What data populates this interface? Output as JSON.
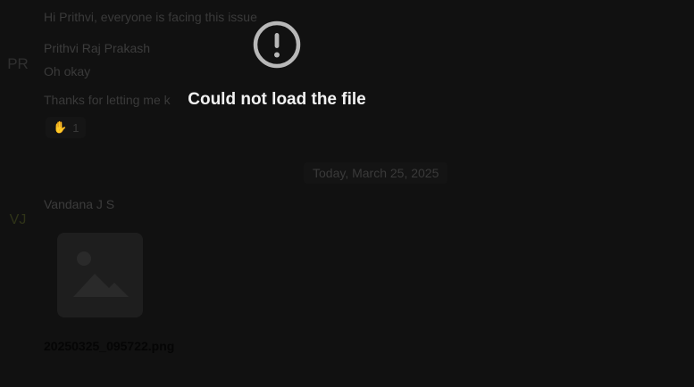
{
  "chat": {
    "messages_before": [
      {
        "text": "Hi Prithvi, everyone is facing this issue"
      }
    ],
    "sender_1": {
      "avatar_initials": "PR",
      "name": "Prithvi Raj Prakash",
      "messages": [
        {
          "text": "Oh okay"
        },
        {
          "text": "Thanks for letting me k"
        }
      ],
      "reaction": {
        "emoji": "✋",
        "count": "1"
      }
    },
    "date_divider": "Today, March 25, 2025",
    "sender_2": {
      "avatar_initials": "VJ",
      "name": "Vandana J S",
      "attachment": {
        "icon": "image-placeholder-icon",
        "file_name": "20250325_095722.png"
      }
    }
  },
  "overlay": {
    "icon": "exclamation-circle-icon",
    "message": "Could not load the file"
  },
  "colors": {
    "overlay_text": "#f2f2f2",
    "overlay_icon": "#b8b8b8",
    "background": "#111111"
  }
}
